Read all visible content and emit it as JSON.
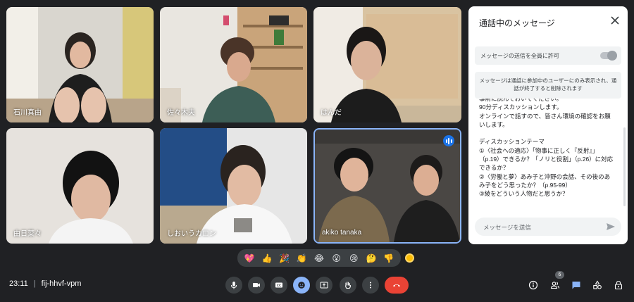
{
  "participants": [
    {
      "name": "石川真由"
    },
    {
      "name": "佐々木夫"
    },
    {
      "name": "はんだ"
    },
    {
      "name": "由日菜々"
    },
    {
      "name": "しおいうカロン"
    },
    {
      "name": "akiko tanaka"
    }
  ],
  "chat": {
    "title": "通話中のメッセージ",
    "allow_label": "メッセージの送信を全員に許可",
    "notice": "メッセージは通話に参加中のユーザーにのみ表示され、通話が終了すると削除されます",
    "message": "事前に読んでおいてください。\n90分ディスカッションします。\nオンラインで話すので、皆さん環境の確認をお願いします。\n\nディスカッションテーマ\n①〈社会への適応〉「物事に正しく『反射』」（p.19）できるか？「ノリと役割」（p.26）に対応できるか？\n②〈労働と夢〉あみ子と沖野の会話、その後のあみ子をどう思ったか？（p.95-99）\n③綾をどういう人物だと思うか？",
    "input_placeholder": "メッセージを送信"
  },
  "reactions": [
    "💖",
    "👍",
    "🎉",
    "👏",
    "😂",
    "😮",
    "😢",
    "🤔",
    "👎"
  ],
  "meeting": {
    "time": "23:11",
    "separator": "|",
    "code": "fij-hhvf-vpm"
  },
  "people_count": "6",
  "colors": {
    "accent": "#8ab4f8",
    "end_call": "#ea4335",
    "background": "#202124"
  }
}
